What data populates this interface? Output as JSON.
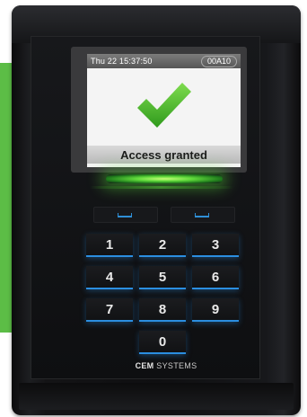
{
  "screen": {
    "datetime": "Thu 22 15:37:50",
    "code": "00A10",
    "message": "Access granted"
  },
  "keypad": {
    "keys": [
      "1",
      "2",
      "3",
      "4",
      "5",
      "6",
      "7",
      "8",
      "9",
      "0"
    ]
  },
  "brand": {
    "name_bold": "CEM",
    "name_rest": " SYSTEMS"
  },
  "colors": {
    "accent_green": "#5cbd46",
    "check_green": "#4cbb2c",
    "key_highlight": "#2b8ee0"
  }
}
